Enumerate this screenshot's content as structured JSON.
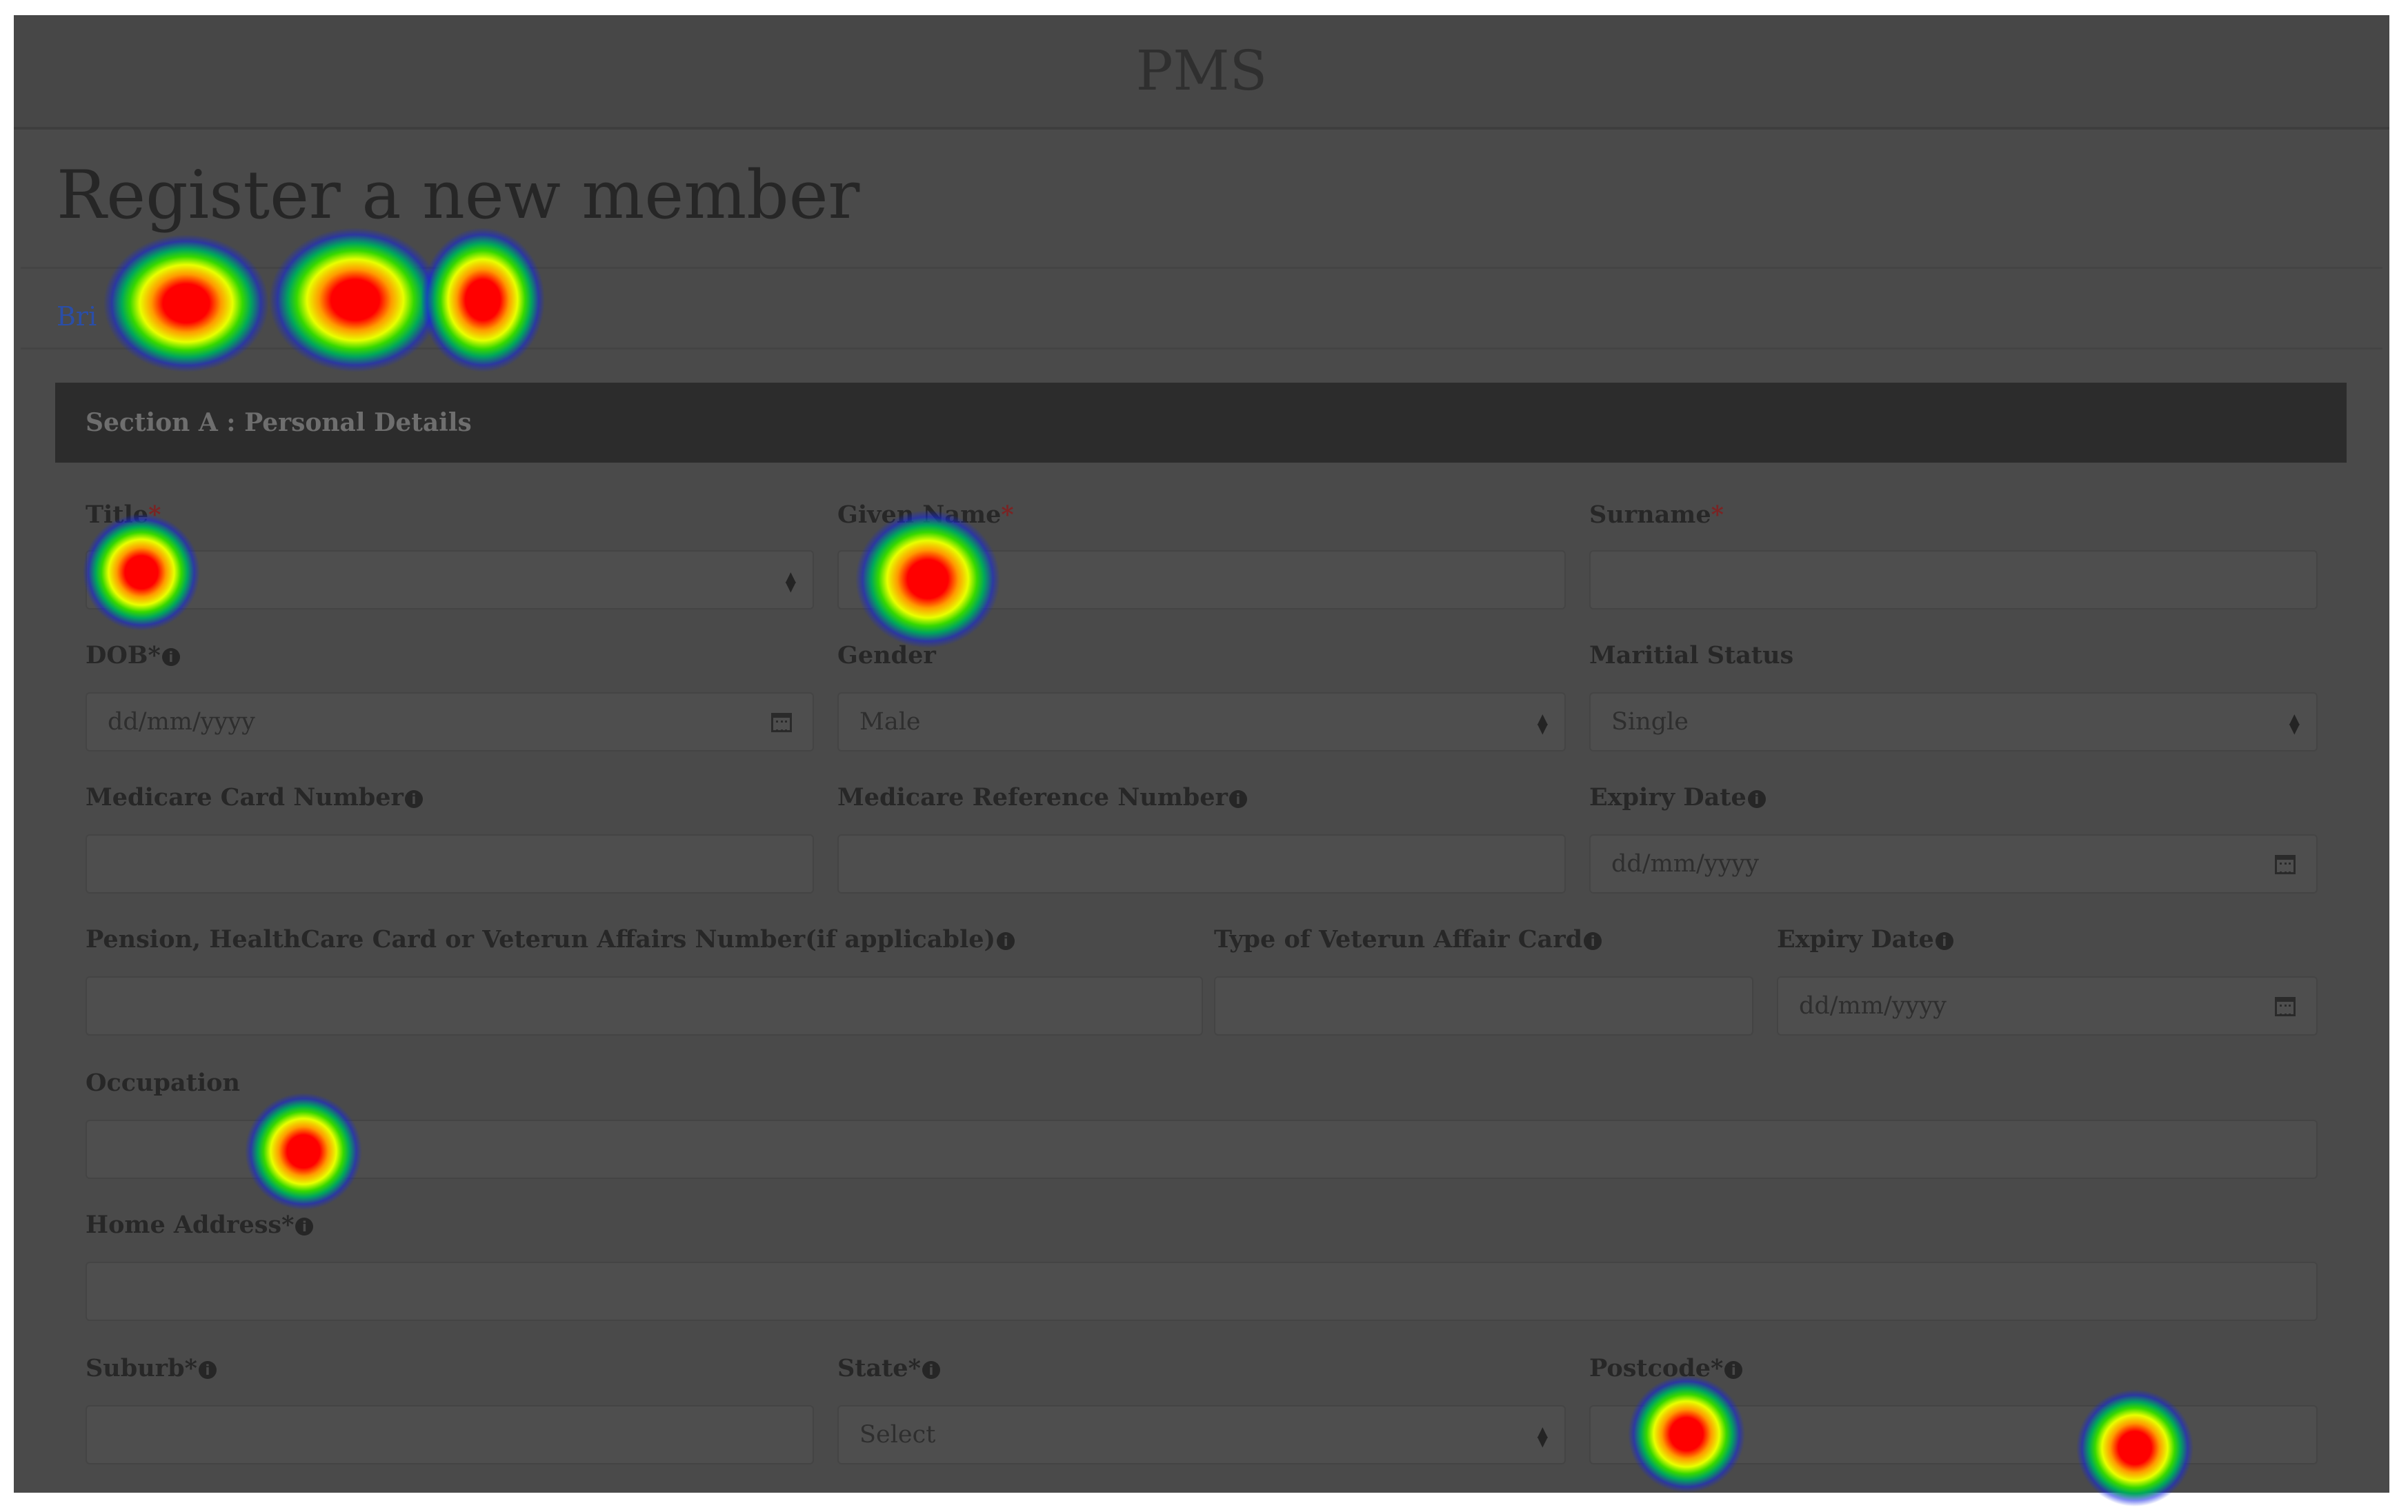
{
  "app": {
    "title": "PMS"
  },
  "page": {
    "title": "Register a new member",
    "breadcrumb": "Bri"
  },
  "section": {
    "title": "Section A : Personal Details"
  },
  "form": {
    "title": {
      "label": "Title",
      "required": "*",
      "value": ""
    },
    "given_name": {
      "label": "Given Name",
      "required": "*",
      "value": ""
    },
    "surname": {
      "label": "Surname",
      "required": "*",
      "value": ""
    },
    "dob": {
      "label": "DOB",
      "required": "*",
      "placeholder": "dd/mm/yyyy"
    },
    "gender": {
      "label": "Gender",
      "value": "Male"
    },
    "marital_status": {
      "label": "Maritial Status",
      "value": "Single"
    },
    "medicare_card_number": {
      "label": "Medicare Card Number",
      "value": ""
    },
    "medicare_reference_number": {
      "label": "Medicare Reference Number",
      "value": ""
    },
    "medicare_expiry": {
      "label": "Expiry Date",
      "placeholder": "dd/mm/yyyy"
    },
    "pension_number": {
      "label": "Pension, HealthCare Card or Veterun Affairs Number(if applicable)",
      "value": ""
    },
    "veteran_card_type": {
      "label": "Type of Veterun Affair Card",
      "value": ""
    },
    "pension_expiry": {
      "label": "Expiry Date",
      "placeholder": "dd/mm/yyyy"
    },
    "occupation": {
      "label": "Occupation",
      "value": ""
    },
    "home_address": {
      "label": "Home Address",
      "required": "*",
      "value": ""
    },
    "suburb": {
      "label": "Suburb",
      "required": "*",
      "value": ""
    },
    "state": {
      "label": "State",
      "required": "*",
      "value": "Select"
    },
    "postcode": {
      "label": "Postcode",
      "required": "*",
      "value": ""
    }
  },
  "icons": {
    "info": "info-circle-icon",
    "calendar": "calendar-icon",
    "select_arrows": "sort-arrows-icon"
  },
  "colors": {
    "background": "#4a4a4a",
    "section_header": "#2c2c2c",
    "link": "#2a4ea8",
    "required": "#7a2424"
  }
}
